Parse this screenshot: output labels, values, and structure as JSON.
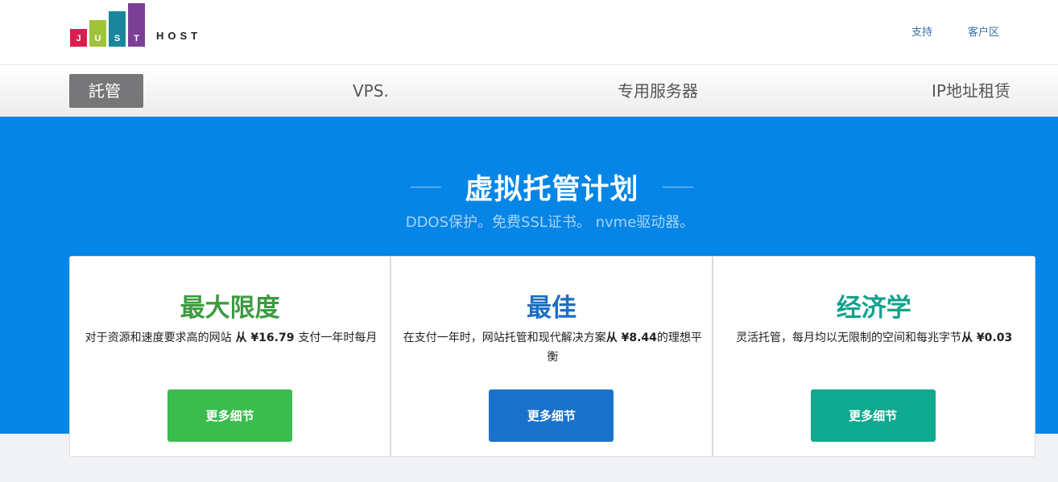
{
  "header": {
    "logo": {
      "letters": [
        "J",
        "U",
        "S",
        "T"
      ],
      "host": "HOST",
      "colors": [
        "#d91f4f",
        "#a0c33a",
        "#19869c",
        "#7b3f96"
      ]
    },
    "links": [
      "支持",
      "客户区"
    ]
  },
  "nav": {
    "items": [
      "託管",
      "VPS.",
      "专用服务器",
      "IP地址租赁"
    ],
    "active_index": 0
  },
  "hero": {
    "title": "虚拟托管计划",
    "subtitle": "DDOS保护。免费SSL证书。 nvme驱动器。",
    "background": "#0585e6"
  },
  "plans": [
    {
      "title": "最大限度",
      "title_color": "#3c9b3f",
      "desc_prefix": "对于资源和速度要求高的网站",
      "desc_price": " 从 ¥16.79 ",
      "desc_suffix": "支付一年时每月",
      "button": "更多细节",
      "button_color": "#3cbb4f"
    },
    {
      "title": "最佳",
      "title_color": "#1d6fc2",
      "desc_prefix": "在支付一年时，网站托管和现代解决方案",
      "desc_price": "从 ¥8.44",
      "desc_suffix": "的理想平衡",
      "button": "更多细节",
      "button_color": "#1a72cb"
    },
    {
      "title": "经济学",
      "title_color": "#13a28d",
      "desc_prefix": "灵活托管，每月均以无限制的空间和每兆字节",
      "desc_price": "从 ¥0.03",
      "desc_suffix": "",
      "button": "更多细节",
      "button_color": "#0ea98e"
    }
  ]
}
